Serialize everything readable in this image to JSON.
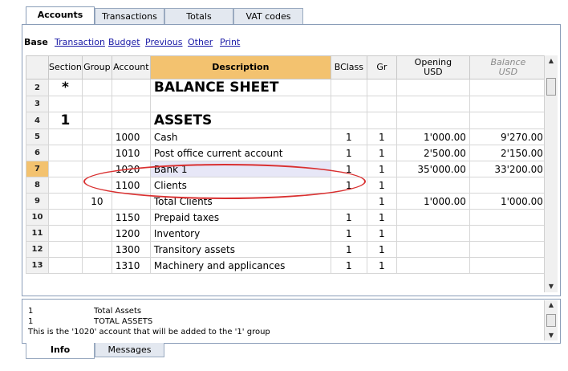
{
  "tabs_top": [
    "Accounts",
    "Transactions",
    "Totals",
    "VAT codes"
  ],
  "views": {
    "current": "Base",
    "links": [
      "Transaction",
      "Budget",
      "Previous",
      "Other",
      "Print"
    ]
  },
  "columns": {
    "section": "Section",
    "group": "Group",
    "account": "Account",
    "description": "Description",
    "bclass": "BClass",
    "gr": "Gr",
    "opening_1": "Opening",
    "opening_2": "USD",
    "balance_1": "Balance",
    "balance_2": "USD"
  },
  "rows": [
    {
      "n": "2",
      "section": "*",
      "group": "",
      "account": "",
      "description": "BALANCE SHEET",
      "bclass": "",
      "gr": "",
      "opening": "",
      "balance": ""
    },
    {
      "n": "3",
      "section": "",
      "group": "",
      "account": "",
      "description": "",
      "bclass": "",
      "gr": "",
      "opening": "",
      "balance": ""
    },
    {
      "n": "4",
      "section": "1",
      "group": "",
      "account": "",
      "description": "ASSETS",
      "bclass": "",
      "gr": "",
      "opening": "",
      "balance": ""
    },
    {
      "n": "5",
      "section": "",
      "group": "",
      "account": "1000",
      "description": "Cash",
      "bclass": "1",
      "gr": "1",
      "opening": "1'000.00",
      "balance": "9'270.00"
    },
    {
      "n": "6",
      "section": "",
      "group": "",
      "account": "1010",
      "description": "Post office current account",
      "bclass": "1",
      "gr": "1",
      "opening": "2'500.00",
      "balance": "2'150.00"
    },
    {
      "n": "7",
      "section": "",
      "group": "",
      "account": "1020",
      "description": "Bank 1",
      "bclass": "1",
      "gr": "1",
      "opening": "35'000.00",
      "balance": "33'200.00"
    },
    {
      "n": "8",
      "section": "",
      "group": "",
      "account": "1100",
      "description": "Clients",
      "bclass": "1",
      "gr": "1",
      "opening": "",
      "balance": ""
    },
    {
      "n": "9",
      "section": "",
      "group": "10",
      "account": "",
      "description": "Total Clients",
      "bclass": "",
      "gr": "1",
      "opening": "1'000.00",
      "balance": "1'000.00"
    },
    {
      "n": "10",
      "section": "",
      "group": "",
      "account": "1150",
      "description": "Prepaid taxes",
      "bclass": "1",
      "gr": "1",
      "opening": "",
      "balance": ""
    },
    {
      "n": "11",
      "section": "",
      "group": "",
      "account": "1200",
      "description": "Inventory",
      "bclass": "1",
      "gr": "1",
      "opening": "",
      "balance": ""
    },
    {
      "n": "12",
      "section": "",
      "group": "",
      "account": "1300",
      "description": "Transitory assets",
      "bclass": "1",
      "gr": "1",
      "opening": "",
      "balance": ""
    },
    {
      "n": "13",
      "section": "",
      "group": "",
      "account": "1310",
      "description": "Machinery and applicances",
      "bclass": "1",
      "gr": "1",
      "opening": "",
      "balance": ""
    }
  ],
  "info_lines": [
    {
      "a": "1",
      "b": "Total Assets"
    },
    {
      "a": "1",
      "b": "TOTAL ASSETS"
    },
    {
      "a": "This is the '1020' account that will be added to the '1' group",
      "b": ""
    }
  ],
  "tabs_bottom": [
    "Info",
    "Messages"
  ]
}
